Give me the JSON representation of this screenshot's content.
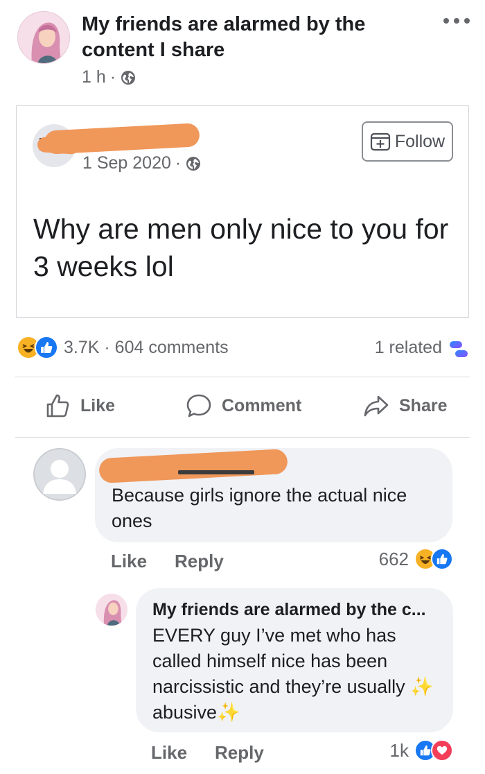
{
  "post": {
    "page_name": "My friends are alarmed by the content I share",
    "time": "1 h",
    "meta_separator": "·"
  },
  "shared": {
    "date": "1 Sep 2020",
    "meta_separator": "·",
    "follow_label": "Follow",
    "text": "Why are men only nice to you for 3 weeks lol"
  },
  "reactions": {
    "count": "3.7K",
    "separator": "·",
    "comments": "604 comments",
    "related": "1 related",
    "icons": [
      "haha-icon",
      "like-icon"
    ]
  },
  "actions": {
    "like": "Like",
    "comment": "Comment",
    "share": "Share"
  },
  "comments": [
    {
      "text": "Because girls ignore the actual nice ones",
      "like_label": "Like",
      "reply_label": "Reply",
      "reaction_count": "662",
      "reaction_icons": [
        "haha-icon",
        "like-icon"
      ]
    },
    {
      "author": "My friends are alarmed by the c...",
      "text_before": "EVERY guy I’ve met who has called himself nice has been narcissistic and they’re usually ",
      "sparkle": "✨",
      "text_middle": "abusive",
      "like_label": "Like",
      "reply_label": "Reply",
      "reaction_count": "1k",
      "reaction_icons": [
        "like-icon",
        "love-icon"
      ]
    }
  ],
  "colors": {
    "redaction": "#f0975a",
    "like_blue": "#1877f2",
    "love_red": "#f33e58",
    "haha_yellow": "#f7b125",
    "secondary_text": "#65676b",
    "bubble_bg": "#f0f2f5"
  }
}
